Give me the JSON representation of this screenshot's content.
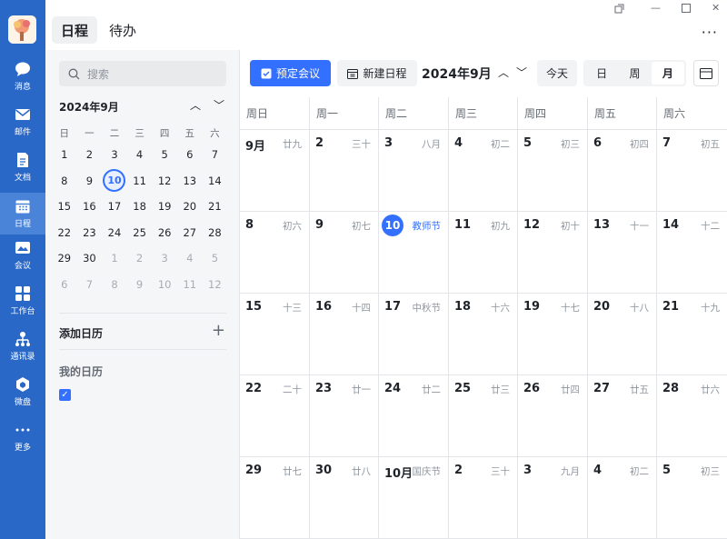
{
  "nav": {
    "items": [
      {
        "label": "消息",
        "icon": "message-icon"
      },
      {
        "label": "邮件",
        "icon": "mail-icon"
      },
      {
        "label": "文档",
        "icon": "docs-icon"
      },
      {
        "label": "日程",
        "icon": "calendar-icon",
        "active": true
      },
      {
        "label": "会议",
        "icon": "meeting-icon"
      },
      {
        "label": "工作台",
        "icon": "workbench-icon"
      },
      {
        "label": "通讯录",
        "icon": "contacts-icon"
      },
      {
        "label": "微盘",
        "icon": "drive-icon"
      },
      {
        "label": "更多",
        "icon": "more-icon"
      }
    ]
  },
  "header": {
    "tab_schedule": "日程",
    "tab_todo": "待办",
    "more": "···"
  },
  "sidebar": {
    "search_placeholder": "搜索",
    "mini_title": "2024年9月",
    "weekdays": [
      "日",
      "一",
      "二",
      "三",
      "四",
      "五",
      "六"
    ],
    "weeks": [
      [
        "1",
        "2",
        "3",
        "4",
        "5",
        "6",
        "7"
      ],
      [
        "8",
        "9",
        "10",
        "11",
        "12",
        "13",
        "14"
      ],
      [
        "15",
        "16",
        "17",
        "18",
        "19",
        "20",
        "21"
      ],
      [
        "22",
        "23",
        "24",
        "25",
        "26",
        "27",
        "28"
      ],
      [
        "29",
        "30",
        "1",
        "2",
        "3",
        "4",
        "5"
      ],
      [
        "6",
        "7",
        "8",
        "9",
        "10",
        "11",
        "12"
      ]
    ],
    "add_calendar": "添加日历",
    "my_calendar": "我的日历"
  },
  "toolbar": {
    "book_meeting": "预定会议",
    "new_event": "新建日程",
    "month_title": "2024年9月",
    "today": "今天",
    "views": [
      "日",
      "周",
      "月"
    ],
    "active_view": "月"
  },
  "calendar": {
    "weekdays": [
      "周日",
      "周一",
      "周二",
      "周三",
      "周四",
      "周五",
      "周六"
    ],
    "rows": [
      [
        {
          "d": "9月",
          "l": "廿九"
        },
        {
          "d": "2",
          "l": "三十"
        },
        {
          "d": "3",
          "l": "八月"
        },
        {
          "d": "4",
          "l": "初二"
        },
        {
          "d": "5",
          "l": "初三"
        },
        {
          "d": "6",
          "l": "初四"
        },
        {
          "d": "7",
          "l": "初五"
        }
      ],
      [
        {
          "d": "8",
          "l": "初六"
        },
        {
          "d": "9",
          "l": "初七"
        },
        {
          "d": "10",
          "l": "教师节",
          "today": true,
          "fest": true
        },
        {
          "d": "11",
          "l": "初九"
        },
        {
          "d": "12",
          "l": "初十"
        },
        {
          "d": "13",
          "l": "十一"
        },
        {
          "d": "14",
          "l": "十二"
        }
      ],
      [
        {
          "d": "15",
          "l": "十三"
        },
        {
          "d": "16",
          "l": "十四"
        },
        {
          "d": "17",
          "l": "中秋节"
        },
        {
          "d": "18",
          "l": "十六"
        },
        {
          "d": "19",
          "l": "十七"
        },
        {
          "d": "20",
          "l": "十八"
        },
        {
          "d": "21",
          "l": "十九"
        }
      ],
      [
        {
          "d": "22",
          "l": "二十"
        },
        {
          "d": "23",
          "l": "廿一"
        },
        {
          "d": "24",
          "l": "廿二"
        },
        {
          "d": "25",
          "l": "廿三"
        },
        {
          "d": "26",
          "l": "廿四"
        },
        {
          "d": "27",
          "l": "廿五"
        },
        {
          "d": "28",
          "l": "廿六"
        }
      ],
      [
        {
          "d": "29",
          "l": "廿七"
        },
        {
          "d": "30",
          "l": "廿八"
        },
        {
          "d": "10月",
          "l": "国庆节"
        },
        {
          "d": "2",
          "l": "三十"
        },
        {
          "d": "3",
          "l": "九月"
        },
        {
          "d": "4",
          "l": "初二"
        },
        {
          "d": "5",
          "l": "初三"
        }
      ]
    ]
  },
  "colors": {
    "nav_bg": "#2a68c8",
    "accent": "#3370ff"
  }
}
